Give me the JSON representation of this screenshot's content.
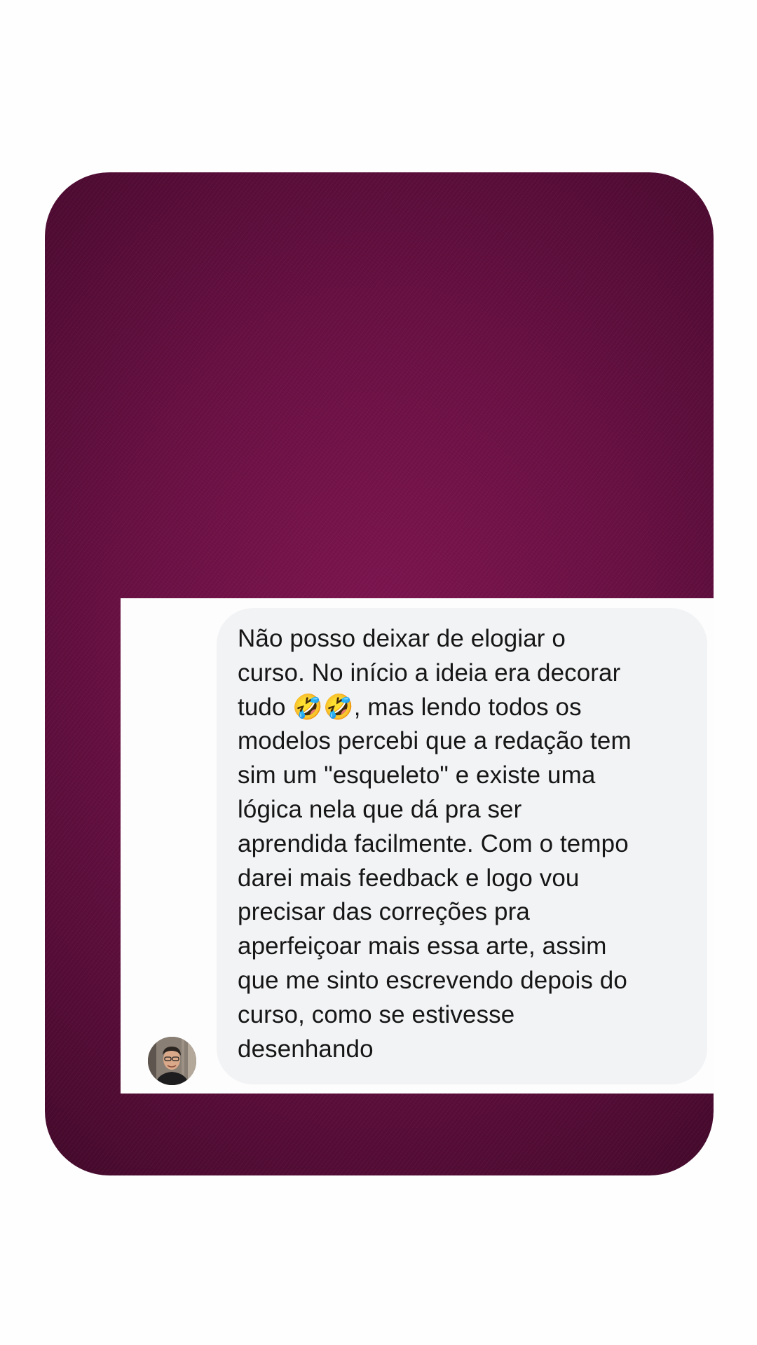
{
  "message": {
    "text": "Não posso deixar de elogiar o\ncurso. No início a ideia era decorar\ntudo 🤣🤣, mas lendo todos os\nmodelos percebi que a redação tem\nsim um \"esqueleto\" e existe uma\nlógica nela que dá pra ser\naprendida facilmente. Com o tempo\ndarei mais feedback e logo vou\nprecisar das correções pra\naperfeiçoar mais essa arte, assim\nque me sinto escrevendo depois do\ncurso, como se estivesse\ndesenhando"
  },
  "colors": {
    "card_background": "#6c1145",
    "panel_background": "#fdfdfd",
    "bubble_background": "#f2f3f5",
    "text": "#161616"
  },
  "icons": {
    "avatar": "sender-avatar-photo"
  }
}
